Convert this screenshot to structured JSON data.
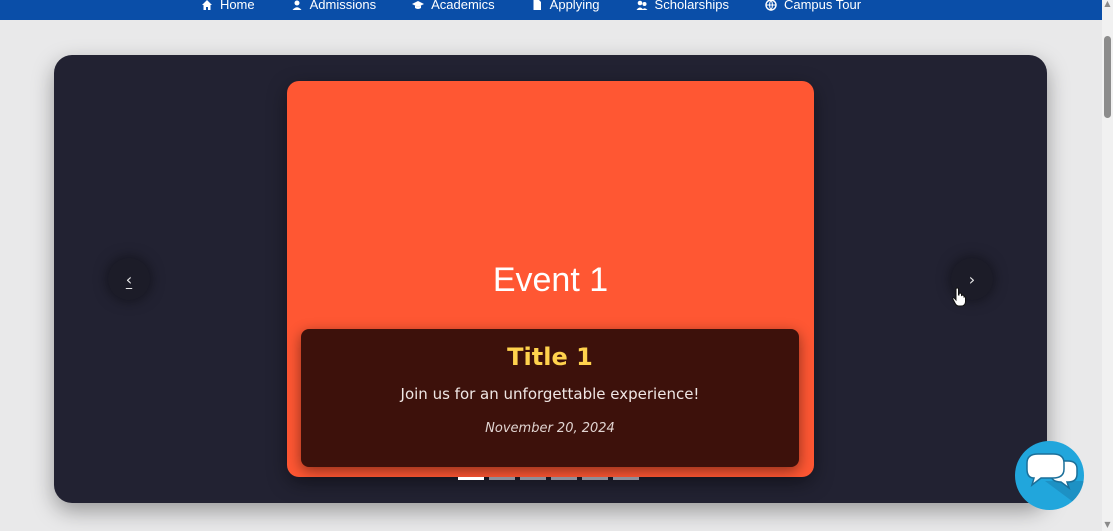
{
  "nav": {
    "items": [
      {
        "label": "Home",
        "icon": "home-icon"
      },
      {
        "label": "Admissions",
        "icon": "admissions-icon"
      },
      {
        "label": "Academics",
        "icon": "academics-icon"
      },
      {
        "label": "Applying",
        "icon": "applying-icon"
      },
      {
        "label": "Scholarships",
        "icon": "scholarships-icon"
      },
      {
        "label": "Campus Tour",
        "icon": "campus-tour-icon"
      }
    ],
    "background": "#0a4ea8"
  },
  "carousel": {
    "prev_label": "‹",
    "next_label": "›",
    "slide": {
      "heading": "Event 1",
      "title": "Title 1",
      "description": "Join us for an unforgettable experience!",
      "date": "November 20, 2024",
      "color": "#ff5733"
    },
    "indicator_count": 6,
    "active_indicator": 1
  },
  "chat": {
    "icon": "chat-bubbles-icon",
    "color": "#21a6dc"
  },
  "colors": {
    "page_bg": "#e9e9ea",
    "carousel_bg": "#222232",
    "caption_bg": "#3d110b",
    "title_color": "#ffd24d"
  }
}
